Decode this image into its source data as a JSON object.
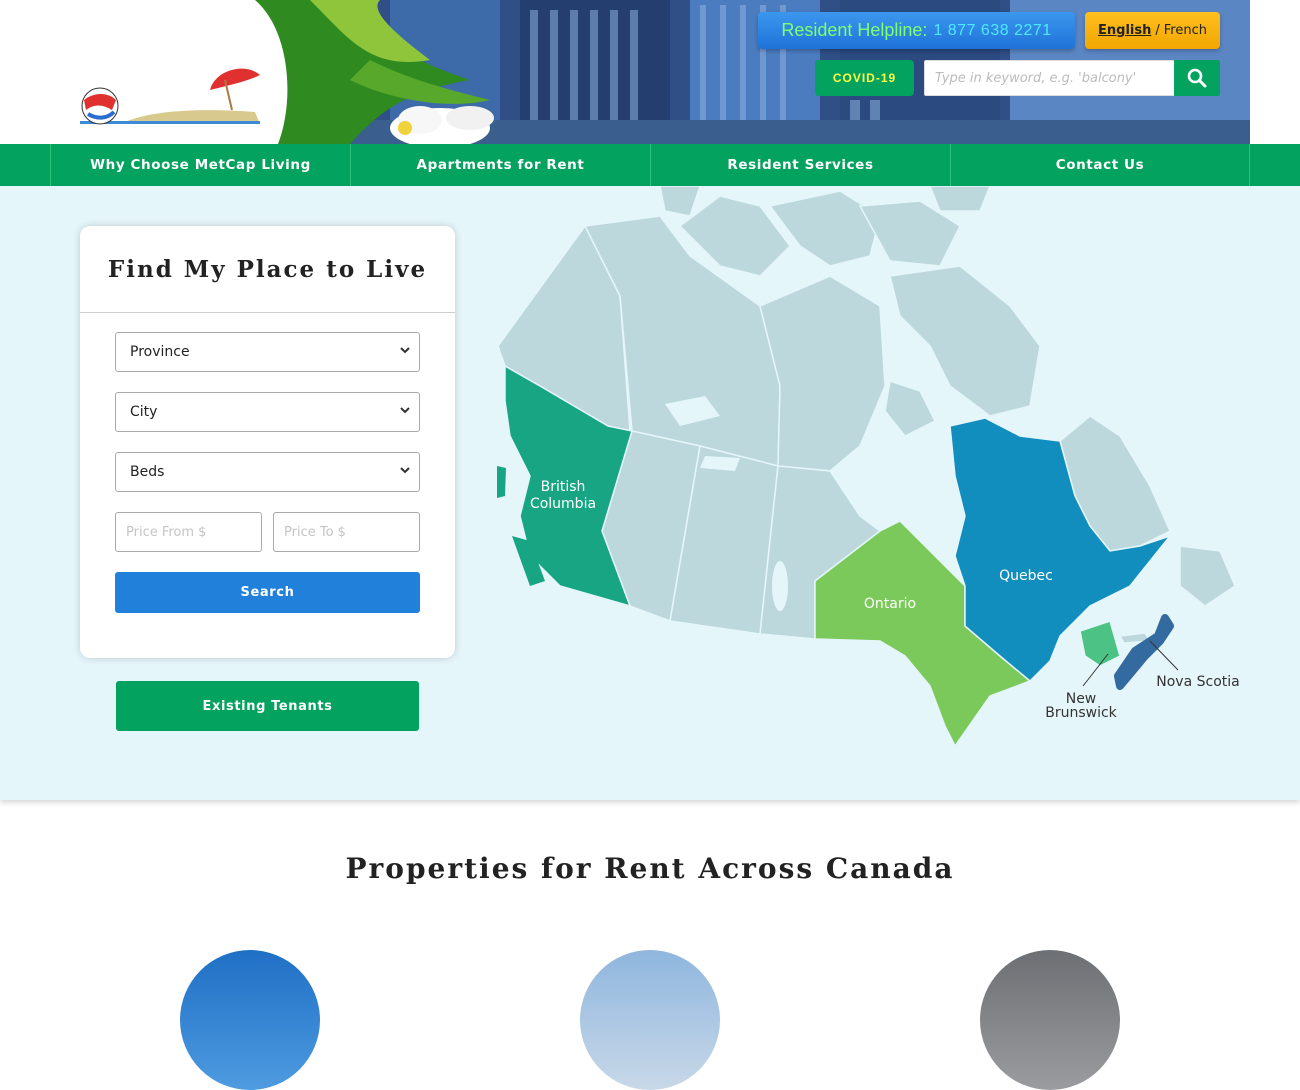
{
  "header": {
    "helpline": {
      "label": "Resident Helpline:",
      "number": "1 877 638 2271"
    },
    "language": {
      "active": "English",
      "separator": "/",
      "other": "French"
    },
    "covid_label": "COVID-19",
    "search": {
      "placeholder": "Type in keyword, e.g. 'balcony'",
      "icon": "search-icon"
    }
  },
  "nav": {
    "items": [
      {
        "label": "Why Choose MetCap Living"
      },
      {
        "label": "Apartments for Rent"
      },
      {
        "label": "Resident Services"
      },
      {
        "label": "Contact Us"
      }
    ]
  },
  "finder": {
    "title": "Find My Place to Live",
    "province": "Province",
    "city": "City",
    "beds": "Beds",
    "price_from_placeholder": "Price From $",
    "price_to_placeholder": "Price To $",
    "search_label": "Search"
  },
  "existing_tenants_label": "Existing Tenants",
  "map": {
    "provinces": {
      "bc": {
        "line1": "British",
        "line2": "Columbia"
      },
      "on": {
        "line1": "Ontario"
      },
      "qc": {
        "line1": "Quebec"
      },
      "nb": {
        "line1": "New",
        "line2": "Brunswick"
      },
      "ns": {
        "line1": "Nova Scotia"
      }
    },
    "colors": {
      "inactive": "#bcd8dc",
      "bc": "#17a584",
      "on": "#7bc95a",
      "qc": "#118ebd",
      "nb": "#4cc384",
      "ns": "#336a9f"
    }
  },
  "section_title": "Properties for Rent Across Canada",
  "colors": {
    "green": "#04a25f",
    "blue": "#2180d9",
    "bg": "#e5f6fa"
  }
}
